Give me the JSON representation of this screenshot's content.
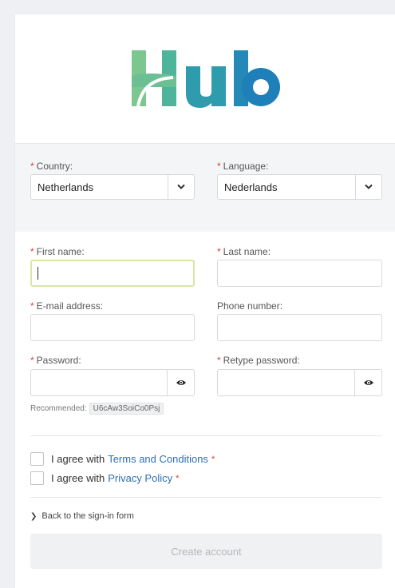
{
  "brand": {
    "logo_text": "Hub",
    "colors": {
      "green": "#7cc68f",
      "teal": "#2a8fb5",
      "blue": "#1f7fb8"
    }
  },
  "locale": {
    "country_label": "Country:",
    "country_value": "Netherlands",
    "language_label": "Language:",
    "language_value": "Nederlands"
  },
  "form": {
    "first_name_label": "First name:",
    "last_name_label": "Last name:",
    "email_label": "E-mail address:",
    "phone_label": "Phone number:",
    "password_label": "Password:",
    "retype_label": "Retype password:",
    "recommended_label": "Recommended:",
    "recommended_password": "U6cAw3SoiCo0Psj",
    "required_marker": "*"
  },
  "agreements": {
    "agree_prefix": "I agree with",
    "terms_link": "Terms and Conditions",
    "privacy_link": "Privacy Policy"
  },
  "actions": {
    "back_label": "Back to the sign-in form",
    "create_label": "Create account"
  },
  "icons": {
    "dropdown": "chevron-down-icon",
    "visibility": "eye-icon",
    "back": "chevron-right-icon"
  }
}
